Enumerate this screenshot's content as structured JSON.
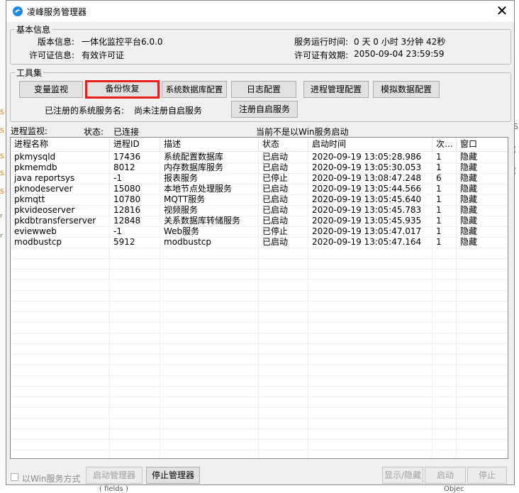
{
  "window": {
    "title": "凌峰服务管理器"
  },
  "info": {
    "group_label": "基本信息",
    "version_label": "版本信息:",
    "version_value": "一体化监控平台6.0.0",
    "license_label": "许可证信息:",
    "license_value": "有效许可证",
    "uptime_label": "服务运行时间:",
    "uptime_value": "0 天 0 小时 3分钟 42秒",
    "expiry_label": "许可证有效期:",
    "expiry_value": "2050-09-04 23:59:59"
  },
  "toolbar": {
    "group_label": "工具集",
    "buttons": [
      "变量监视",
      "备份恢复",
      "系统数据库配置",
      "日志配置",
      "进程管理配置",
      "模拟数据配置"
    ],
    "registered_label": "已注册的系统服务名:",
    "registered_value": "尚未注册自启服务",
    "register_button": "注册自启服务"
  },
  "monitor": {
    "label": "进程监视:",
    "status_label": "状态:",
    "status_value": "已连接",
    "win_service_note": "当前不是以Win服务启动"
  },
  "table": {
    "columns": [
      "进程名称",
      "进程ID",
      "描述",
      "状态",
      "启动时间",
      "次…",
      "窗口"
    ],
    "rows": [
      [
        "pkmysqld",
        "17436",
        "系统配置数据库",
        "已启动",
        "2020-09-19 13:05:28.986",
        "1",
        "隐藏"
      ],
      [
        "pkmemdb",
        "8012",
        "内存数据库服务",
        "已启动",
        "2020-09-19 13:05:30.053",
        "1",
        "隐藏"
      ],
      [
        "java reportsys",
        "-1",
        "报表服务",
        "已停止",
        "2020-09-19 13:08:47.248",
        "6",
        "隐藏"
      ],
      [
        "pknodeserver",
        "15080",
        "本地节点处理服务",
        "已启动",
        "2020-09-19 13:05:44.566",
        "1",
        "隐藏"
      ],
      [
        "pkmqtt",
        "10780",
        "MQTT服务",
        "已启动",
        "2020-09-19 13:05:45.640",
        "1",
        "隐藏"
      ],
      [
        "pkvideoserver",
        "12816",
        "视频服务",
        "已启动",
        "2020-09-19 13:05:45.783",
        "1",
        "隐藏"
      ],
      [
        "pkdbtransferserver",
        "12848",
        "关系数据库转储服务",
        "已启动",
        "2020-09-19 13:05:45.935",
        "1",
        "隐藏"
      ],
      [
        "eviewweb",
        "-1",
        "Web服务",
        "已停止",
        "2020-09-19 13:05:47.017",
        "1",
        "隐藏"
      ],
      [
        "modbustcp",
        "5912",
        "modbustcp",
        "已启动",
        "2020-09-19 13:05:47.164",
        "1",
        "隐藏"
      ]
    ]
  },
  "footer": {
    "win_service_checkbox": "以Win服务方式",
    "start_manager": "启动管理器",
    "stop_manager": "停止管理器",
    "show_hide": "显示/隐藏",
    "start": "启动",
    "stop": "停止"
  },
  "background": {
    "right_frag_1": "S",
    "right_frag_2": "(",
    "bottom_frag": "( fields )",
    "bottom_right_frag": "Objec"
  },
  "colors": {
    "highlight_border": "#e81c1c",
    "app_icon": "#1e88e5"
  }
}
